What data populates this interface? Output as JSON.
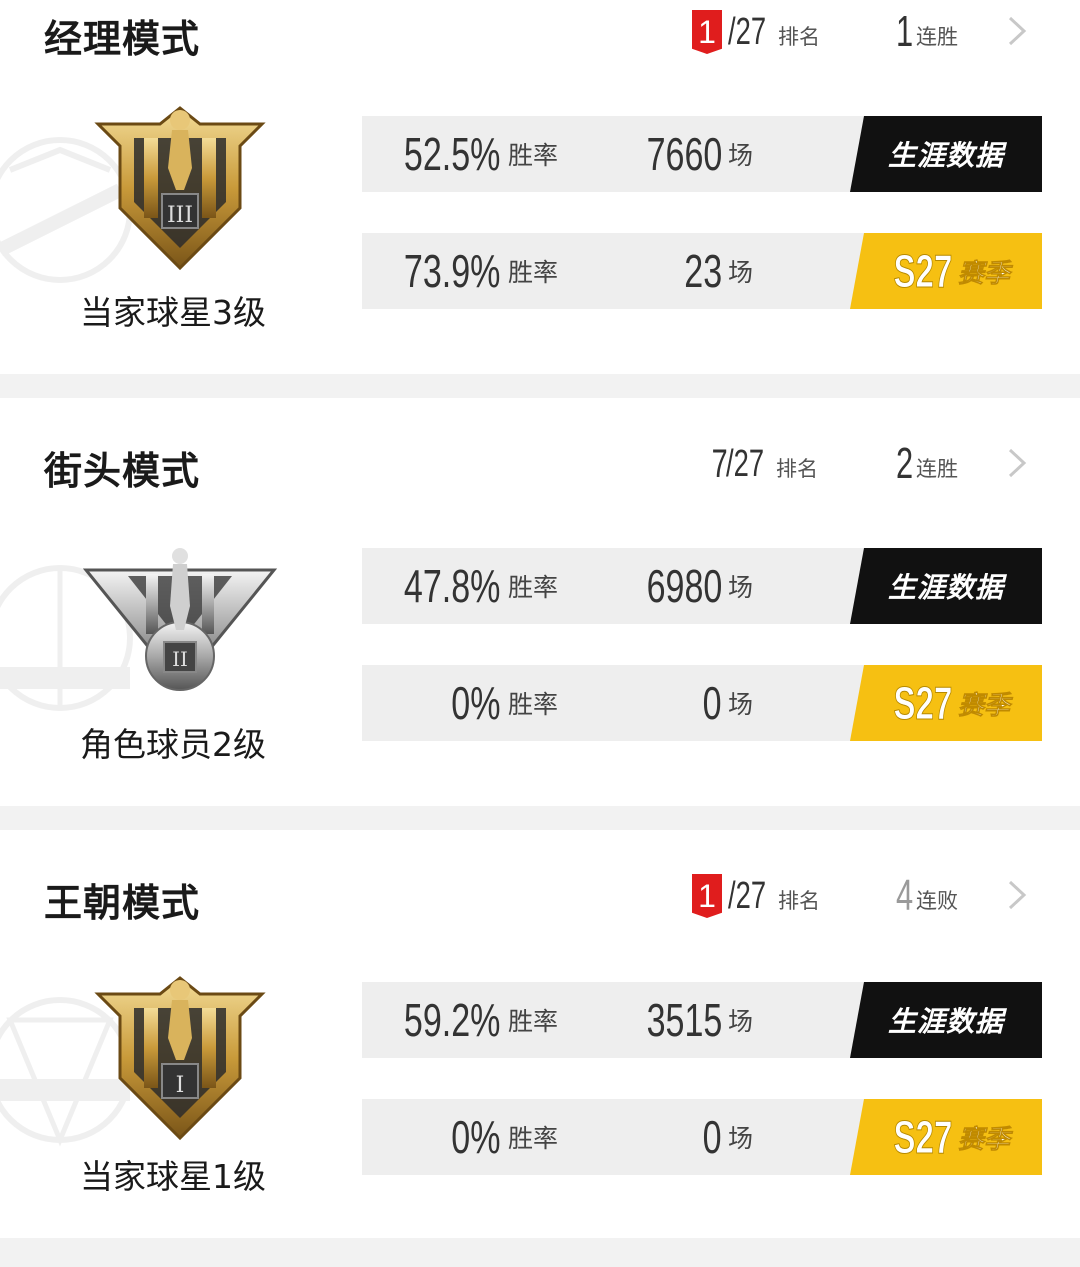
{
  "modes": [
    {
      "title": "经理模式",
      "rank": "1",
      "rank_is_top": true,
      "rank_total": "/27",
      "rank_label": "排名",
      "streak": "1",
      "streak_type": "win",
      "streak_label": "连胜",
      "level": "当家球星3级",
      "emblem": "gold-trophy-emblem",
      "career": {
        "win_rate": "52.5%",
        "win_rate_label": "胜率",
        "games": "7660",
        "games_label": "场",
        "tag": "生涯数据"
      },
      "season": {
        "win_rate": "73.9%",
        "win_rate_label": "胜率",
        "games": "23",
        "games_label": "场",
        "season_code": "S27",
        "season_label": "赛季"
      }
    },
    {
      "title": "街头模式",
      "rank": "7",
      "rank_is_top": false,
      "rank_total": "/27",
      "rank_label": "排名",
      "streak": "2",
      "streak_type": "win",
      "streak_label": "连胜",
      "level": "角色球员2级",
      "emblem": "silver-trophy-emblem",
      "career": {
        "win_rate": "47.8%",
        "win_rate_label": "胜率",
        "games": "6980",
        "games_label": "场",
        "tag": "生涯数据"
      },
      "season": {
        "win_rate": "0%",
        "win_rate_label": "胜率",
        "games": "0",
        "games_label": "场",
        "season_code": "S27",
        "season_label": "赛季"
      }
    },
    {
      "title": "王朝模式",
      "rank": "1",
      "rank_is_top": true,
      "rank_total": "/27",
      "rank_label": "排名",
      "streak": "4",
      "streak_type": "lose",
      "streak_label": "连败",
      "level": "当家球星1级",
      "emblem": "gold-trophy-emblem",
      "career": {
        "win_rate": "59.2%",
        "win_rate_label": "胜率",
        "games": "3515",
        "games_label": "场",
        "tag": "生涯数据"
      },
      "season": {
        "win_rate": "0%",
        "win_rate_label": "胜率",
        "games": "0",
        "games_label": "场",
        "season_code": "S27",
        "season_label": "赛季"
      }
    }
  ],
  "colors": {
    "rank_top": "#e01d1d",
    "career_tag": "#111111",
    "season_tag": "#f6c012",
    "gold": "#c9a24a",
    "silver": "#b8b8b8"
  }
}
